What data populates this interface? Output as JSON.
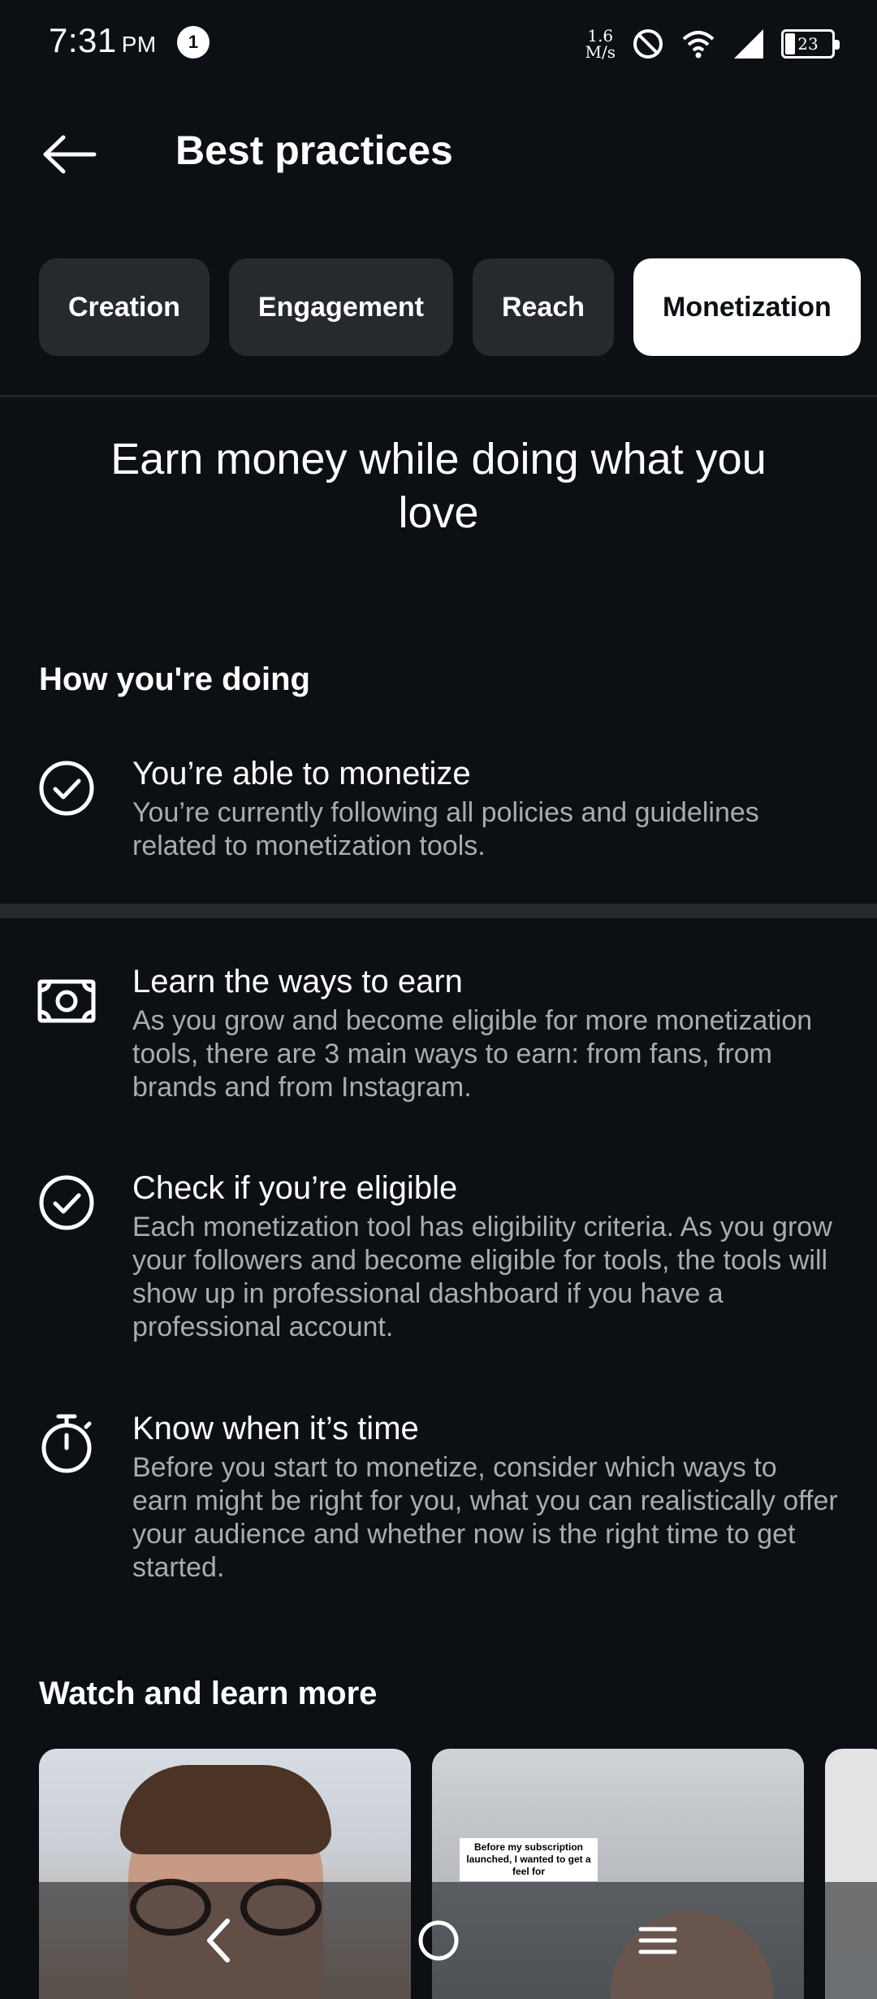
{
  "status_bar": {
    "time": "7:31",
    "ampm": "PM",
    "notification_count": "1",
    "net_speed_value": "1.6",
    "net_speed_unit": "M/s",
    "battery": "23"
  },
  "header": {
    "title": "Best practices"
  },
  "tabs": [
    {
      "label": "Creation",
      "active": false
    },
    {
      "label": "Engagement",
      "active": false
    },
    {
      "label": "Reach",
      "active": false
    },
    {
      "label": "Monetization",
      "active": true
    }
  ],
  "hero": {
    "title": "Earn money while doing what you love"
  },
  "status_section": {
    "heading": "How you're doing",
    "item": {
      "icon": "check-circle-icon",
      "title": "You’re able to monetize",
      "description": "You’re currently following all policies and guidelines related to monetization tools."
    }
  },
  "tips": [
    {
      "icon": "money-bill-icon",
      "title": "Learn the ways to earn",
      "description": "As you grow and become eligible for more monetization tools, there are 3 main ways to earn: from fans, from brands and from Instagram."
    },
    {
      "icon": "check-circle-icon",
      "title": "Check if you’re eligible",
      "description": "Each monetization tool has eligibility criteria. As you grow your followers and become eligible for tools, the tools will show up in professional dashboard if you have a professional account."
    },
    {
      "icon": "stopwatch-icon",
      "title": "Know when it’s time",
      "description": "Before you start to monetize, consider which ways to earn might be right for you, what you can realistically offer your audience and whether now is the right time to get started."
    }
  ],
  "videos": {
    "heading": "Watch and learn more",
    "thumb2_caption": "Before my subscription launched, I wanted to get a feel for"
  },
  "colors": {
    "background": "#0c1014",
    "chip": "#262a2f",
    "secondary_text": "#a8acb2"
  }
}
